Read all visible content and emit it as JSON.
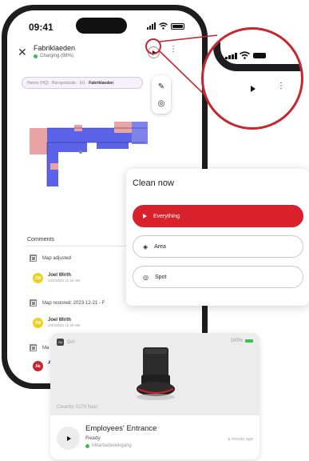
{
  "phone": {
    "status_bar": {
      "time": "09:41"
    },
    "header": {
      "close_icon": "close-icon",
      "device_name": "Fabriklaeden",
      "device_status": "Charging (98%)",
      "play_icon": "play-icon",
      "more_icon": "more-vertical-icon"
    },
    "breadcrumb": {
      "path": "Heimo (HQ) · Bürogebäude · EG ·",
      "current": "Fabriklaeden"
    },
    "tools": {
      "edit_icon": "pencil-icon",
      "locate_icon": "target-icon"
    },
    "comments": {
      "title": "Comments",
      "items": [
        {
          "type": "event",
          "text": "Map adjusted"
        },
        {
          "type": "user",
          "initials": "JW",
          "name": "Joel Wirth",
          "date": "2/22/2024 11:42 AM"
        },
        {
          "type": "event",
          "text": "Map restored: 2023-12-21 - F"
        },
        {
          "type": "user",
          "initials": "JW",
          "name": "Joel Wirth",
          "date": "2/20/2024 11:40 AM"
        },
        {
          "type": "event",
          "text": "Ma"
        },
        {
          "type": "user",
          "initials": "Ak",
          "name": "Ak",
          "date": ""
        }
      ]
    }
  },
  "zoom": {
    "play_icon": "play-icon",
    "more_icon": "more-vertical-icon",
    "accent_color": "#c4272f"
  },
  "clean_now": {
    "title": "Clean now",
    "options": [
      {
        "label": "Everything",
        "icon": "play-icon",
        "active": true
      },
      {
        "label": "Area",
        "icon": "layers-icon",
        "active": false
      },
      {
        "label": "Spot",
        "icon": "spot-target-icon",
        "active": false
      }
    ],
    "accent_color": "#d8212a"
  },
  "robot_card": {
    "brand_short": "Gn",
    "brand_label": "Gn²",
    "battery": "100%",
    "model": "Cleanfix S170 Navi",
    "location_name": "Employees' Entrance",
    "status": "Ready",
    "room": "Mitarbeitereingang",
    "time_ago": "a minute ago",
    "play_icon": "play-icon"
  }
}
